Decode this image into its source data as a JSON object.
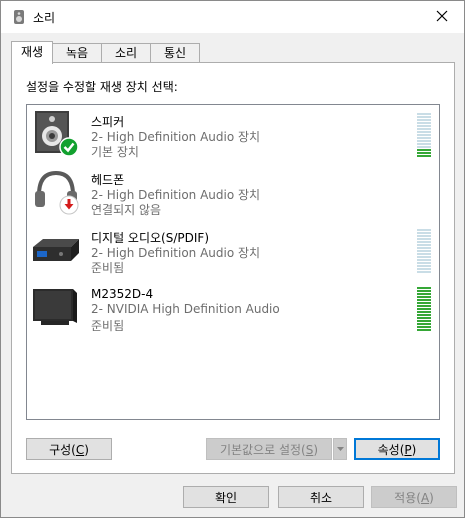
{
  "window": {
    "title": "소리",
    "icon": "speaker-icon"
  },
  "tabs": [
    {
      "label": "재생",
      "active": true
    },
    {
      "label": "녹음",
      "active": false
    },
    {
      "label": "소리",
      "active": false
    },
    {
      "label": "통신",
      "active": false
    }
  ],
  "panel": {
    "instruction": "설정을 수정할 재생 장치 선택:",
    "devices": [
      {
        "name": "스피커",
        "description": "2- High Definition Audio 장치",
        "status": "기본 장치",
        "icon": "speaker-default-icon",
        "meter_color": "#bfd8e0",
        "level": 0.2
      },
      {
        "name": "헤드폰",
        "description": "2- High Definition Audio 장치",
        "status": "연결되지 않음",
        "icon": "headphones-disconnected-icon",
        "level": 0
      },
      {
        "name": "디지털 오디오(S/PDIF)",
        "description": "2- High Definition Audio 장치",
        "status": "준비됨",
        "icon": "digital-audio-icon",
        "level": 0
      },
      {
        "name": "M2352D-4",
        "description": "2- NVIDIA High Definition Audio",
        "status": "준비됨",
        "icon": "monitor-icon",
        "level": 1.0
      }
    ]
  },
  "buttons": {
    "configure": {
      "label": "구성",
      "mnemonic": "C"
    },
    "set_default": {
      "label": "기본값으로 설정",
      "mnemonic": "S"
    },
    "properties": {
      "label": "속성",
      "mnemonic": "P"
    },
    "ok": "확인",
    "cancel": "취소",
    "apply": {
      "label": "적용",
      "mnemonic": "A"
    }
  },
  "colors": {
    "meter_green": "#35a736",
    "meter_idle": "#c9dde6",
    "check_green": "#12a12f",
    "disconnect_red": "#d41b1b",
    "focus_blue": "#0078d7"
  }
}
